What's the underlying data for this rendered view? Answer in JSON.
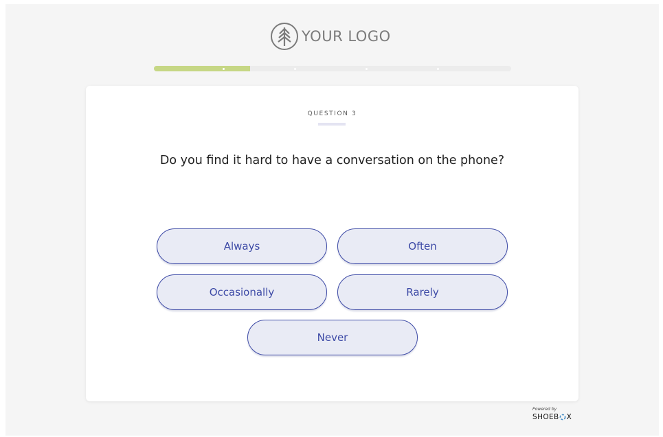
{
  "logo": {
    "text": "YOUR LOGO",
    "icon": "tree-icon"
  },
  "progress": {
    "fill_fraction": 0.27,
    "color": "#c6d785",
    "step_markers": [
      0.195,
      0.395,
      0.595,
      0.795
    ]
  },
  "question": {
    "label": "QUESTION 3",
    "text": "Do you find it hard to have a conversation on the phone?"
  },
  "answers": [
    "Always",
    "Often",
    "Occasionally",
    "Rarely",
    "Never"
  ],
  "footer": {
    "powered_by": "Powered by",
    "brand_before": "SHOEB",
    "brand_after": "X"
  },
  "colors": {
    "accent": "#3d4aa6",
    "answer_background": "#e9ebf5",
    "page_background": "#f5f5f5"
  }
}
